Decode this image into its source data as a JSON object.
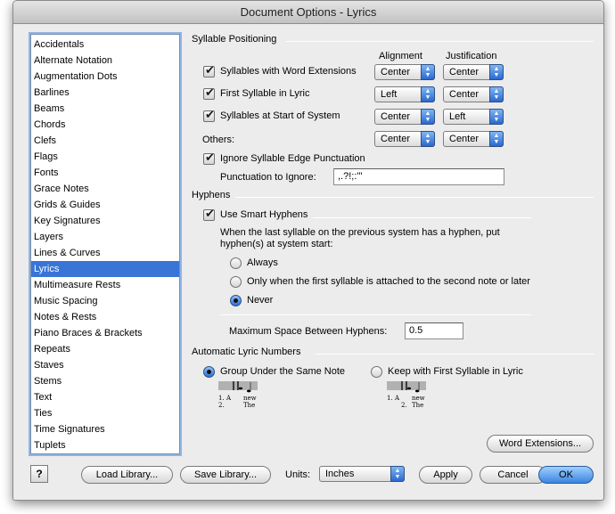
{
  "window": {
    "title": "Document Options - Lyrics"
  },
  "sidebar": {
    "items": [
      "Accidentals",
      "Alternate Notation",
      "Augmentation Dots",
      "Barlines",
      "Beams",
      "Chords",
      "Clefs",
      "Flags",
      "Fonts",
      "Grace Notes",
      "Grids & Guides",
      "Key Signatures",
      "Layers",
      "Lines & Curves",
      "Lyrics",
      "Multimeasure Rests",
      "Music Spacing",
      "Notes & Rests",
      "Piano Braces & Brackets",
      "Repeats",
      "Staves",
      "Stems",
      "Text",
      "Ties",
      "Time Signatures",
      "Tuplets"
    ],
    "selected": "Lyrics"
  },
  "syllable_positioning": {
    "title": "Syllable Positioning",
    "col_alignment": "Alignment",
    "col_justification": "Justification",
    "rows": [
      {
        "label": "Syllables with Word Extensions",
        "checked": true,
        "alignment": "Center",
        "justification": "Center"
      },
      {
        "label": "First Syllable in Lyric",
        "checked": true,
        "alignment": "Left",
        "justification": "Center"
      },
      {
        "label": "Syllables at Start of System",
        "checked": true,
        "alignment": "Center",
        "justification": "Left"
      }
    ],
    "others_label": "Others:",
    "others_alignment": "Center",
    "others_justification": "Center",
    "ignore_edge_label": "Ignore Syllable Edge Punctuation",
    "ignore_edge_checked": true,
    "punct_label": "Punctuation to Ignore:",
    "punct_value": ",.?!;:'\""
  },
  "hyphens": {
    "title": "Hyphens",
    "smart_label": "Use Smart Hyphens",
    "smart_checked": true,
    "description_line1": "When the last syllable on the previous system has a hyphen, put",
    "description_line2": "hyphen(s) at system start:",
    "options": [
      {
        "label": "Always",
        "selected": false
      },
      {
        "label": "Only when the first syllable is attached to the second note or later",
        "selected": false
      },
      {
        "label": "Never",
        "selected": true
      }
    ],
    "max_space_label": "Maximum Space Between Hyphens:",
    "max_space_value": "0.5"
  },
  "lyric_numbers": {
    "title": "Automatic Lyric Numbers",
    "option1": "Group Under the Same Note",
    "option2": "Keep with First Syllable in Lyric",
    "selected": "option1",
    "sample1": {
      "line1_num": "1.",
      "line1_word": "A",
      "line1_word2": "new",
      "line2_num": "2.",
      "line2_word": "The"
    },
    "sample2": {
      "line1_num": "1.",
      "line1_word": "A",
      "line1_word2": "new",
      "line2_num": "2.",
      "line2_word": "The"
    }
  },
  "buttons": {
    "word_extensions": "Word Extensions...",
    "help": "?",
    "load_library": "Load Library...",
    "save_library": "Save Library...",
    "units_label": "Units:",
    "units_value": "Inches",
    "apply": "Apply",
    "cancel": "Cancel",
    "ok": "OK"
  }
}
